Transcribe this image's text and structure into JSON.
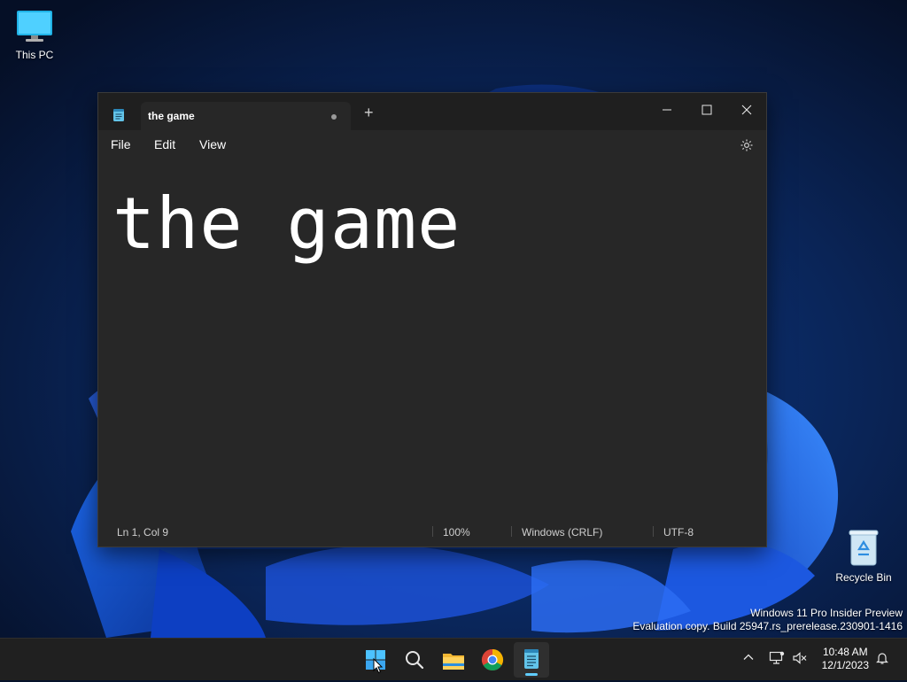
{
  "desktop": {
    "icons": [
      {
        "label": "This PC"
      },
      {
        "label": "Recycle Bin"
      }
    ],
    "watermark": {
      "line1": "Windows 11 Pro Insider Preview",
      "line2": "Evaluation copy. Build 25947.rs_prerelease.230901-1416"
    }
  },
  "notepad": {
    "tab_title": "the game",
    "tab_unsaved": true,
    "new_tab_label": "+",
    "menu": [
      "File",
      "Edit",
      "View"
    ],
    "document_text": "the game",
    "status": {
      "position": "Ln 1, Col 9",
      "zoom": "100%",
      "line_ending": "Windows (CRLF)",
      "encoding": "UTF-8"
    }
  },
  "taskbar": {
    "apps": [
      "start-icon",
      "search-icon",
      "file-explorer-icon",
      "chrome-icon",
      "notepad-icon"
    ],
    "active_app": "notepad",
    "clock": {
      "time": "10:48 AM",
      "date": "12/1/2023"
    }
  },
  "colors": {
    "accent": "#60cdff",
    "window_bg": "#272727",
    "titlebar_bg": "#1f1f1f",
    "taskbar_bg": "#202020"
  }
}
